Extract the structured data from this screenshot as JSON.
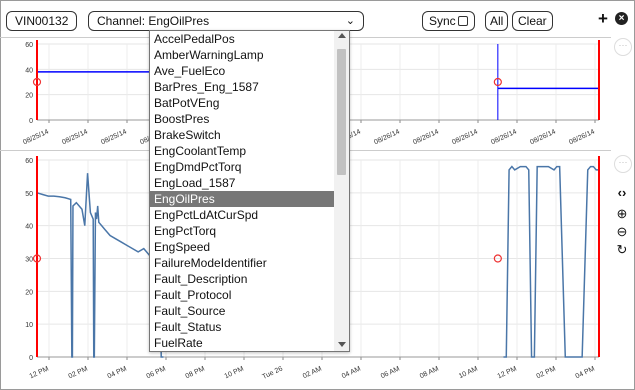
{
  "toolbar": {
    "vin_label": "VIN00132",
    "channel_label": "Channel:",
    "channel_value": "EngOilPres",
    "sync_label": "Sync",
    "all_label": "All",
    "clear_label": "Clear"
  },
  "dropdown": {
    "options": [
      "AccelPedalPos",
      "AmberWarningLamp",
      "Ave_FuelEco",
      "BarPres_Eng_1587",
      "BatPotVEng",
      "BoostPres",
      "BrakeSwitch",
      "EngCoolantTemp",
      "EngDmdPctTorq",
      "EngLoad_1587",
      "EngOilPres",
      "EngPctLdAtCurSpd",
      "EngPctTorq",
      "EngSpeed",
      "FailureModeIdentifier",
      "Fault_Description",
      "Fault_Protocol",
      "Fault_Source",
      "Fault_Status",
      "FuelRate"
    ],
    "selected": "EngOilPres"
  },
  "chart_data": [
    {
      "type": "line",
      "ylim": [
        0,
        60
      ],
      "y_ticks": [
        "60",
        "40",
        "20",
        "0"
      ],
      "x_ticks": [
        "08/25/14",
        "08/25/14",
        "08/25/14",
        "08/25/14",
        "08/25/14",
        "08/25/14",
        "08/26/14",
        "08/26/14",
        "08/26/14",
        "08/26/14",
        "08/26/14",
        "08/26/14",
        "08/26/14",
        "08/26/14",
        "08/26/14"
      ],
      "series": [
        {
          "color": "#0000ff",
          "segments": [
            {
              "x": [
                0.0,
                0.35
              ],
              "y": [
                38,
                38
              ]
            },
            {
              "x": [
                0.82,
                1.0
              ],
              "y": [
                25,
                25
              ]
            }
          ]
        }
      ],
      "markers": [
        {
          "x": 0.0,
          "y": 30
        },
        {
          "x": 0.82,
          "y": 30
        }
      ],
      "cursor_lines": [
        {
          "x": 0.82,
          "color": "#0000ff"
        }
      ],
      "bounds": [
        {
          "x": 0.0,
          "color": "#ff0000"
        },
        {
          "x": 1.0,
          "color": "#ff0000"
        }
      ]
    },
    {
      "type": "line",
      "ylim": [
        0,
        60
      ],
      "y_ticks": [
        "60",
        "50",
        "40",
        "30",
        "20",
        "10",
        "0"
      ],
      "x_ticks": [
        "12 PM",
        "02 PM",
        "04 PM",
        "06 PM",
        "08 PM",
        "10 PM",
        "Tue 26",
        "02 AM",
        "04 AM",
        "06 AM",
        "08 AM",
        "10 AM",
        "12 PM",
        "02 PM",
        "04 PM"
      ],
      "series": [
        {
          "color": "#4a76a8",
          "segments": [
            {
              "x": [
                0.0,
                0.01,
                0.02,
                0.03,
                0.04,
                0.05,
                0.06,
                0.062,
                0.063,
                0.064,
                0.07,
                0.08,
                0.085,
                0.09,
                0.095,
                0.1,
                0.101,
                0.102,
                0.104,
                0.106,
                0.108,
                0.11,
                0.115,
                0.12,
                0.125,
                0.13,
                0.14,
                0.15,
                0.16,
                0.17,
                0.18,
                0.19,
                0.2,
                0.21,
                0.215,
                0.22,
                0.221,
                0.222,
                0.223,
                0.225
              ],
              "y": [
                50,
                49.5,
                49,
                49,
                48.8,
                48.5,
                48,
                0,
                0,
                46,
                47,
                45,
                40,
                56,
                44,
                42,
                0,
                0,
                44,
                42,
                46,
                41,
                40,
                39,
                38,
                37,
                36,
                35,
                34,
                33,
                32,
                33,
                31,
                31,
                30,
                29,
                0,
                0,
                0,
                0
              ]
            },
            {
              "x": [
                0.83,
                0.835,
                0.84,
                0.845,
                0.85,
                0.86,
                0.87,
                0.875,
                0.88,
                0.885,
                0.89,
                0.9,
                0.91,
                0.92,
                0.925,
                0.93,
                0.94,
                0.95,
                0.96,
                0.97,
                0.98,
                0.985,
                0.99,
                0.995,
                1.0
              ],
              "y": [
                0,
                0,
                57,
                58,
                57,
                58,
                58,
                57,
                0,
                0,
                58,
                58,
                58,
                57,
                58,
                58,
                0,
                0,
                0,
                0,
                57,
                58,
                58,
                57,
                57
              ]
            }
          ]
        }
      ],
      "markers": [
        {
          "x": 0.0,
          "y": 30
        },
        {
          "x": 0.82,
          "y": 30
        }
      ],
      "bounds": [
        {
          "x": 0.0,
          "color": "#ff0000"
        },
        {
          "x": 1.0,
          "color": "#ff0000"
        }
      ]
    }
  ],
  "side_icons": [
    "chevrons-icon",
    "zoom-in-icon",
    "zoom-out-icon",
    "reset-icon"
  ]
}
